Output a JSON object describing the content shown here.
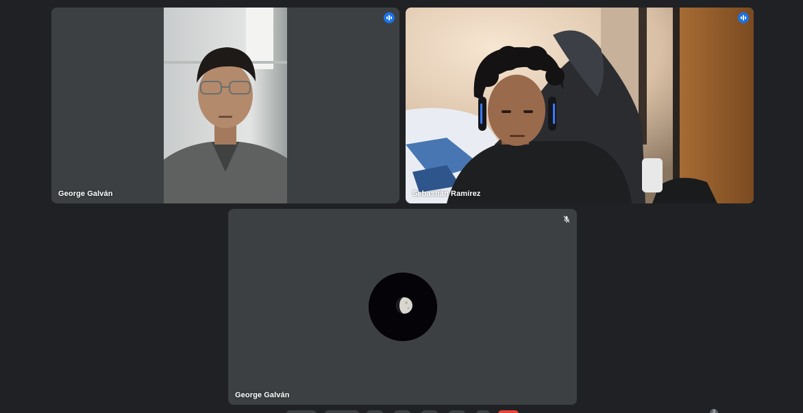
{
  "meeting": {
    "participants": [
      {
        "name": "George Galván",
        "speaking": true,
        "camera": "on"
      },
      {
        "name": "Sebastián Ramírez",
        "speaking": true,
        "camera": "on",
        "active_speaker": true
      },
      {
        "name": "George Galván",
        "speaking": false,
        "camera": "off",
        "muted": true
      }
    ],
    "participant_count": "3"
  },
  "icons": {
    "speaking": "audio-level-icon",
    "muted": "mic-off-icon",
    "avatar": "moon-avatar"
  },
  "colors": {
    "background": "#202124",
    "tile": "#3c4043",
    "active_border": "#8ab4f8",
    "speaking_badge": "#1a73e8"
  }
}
